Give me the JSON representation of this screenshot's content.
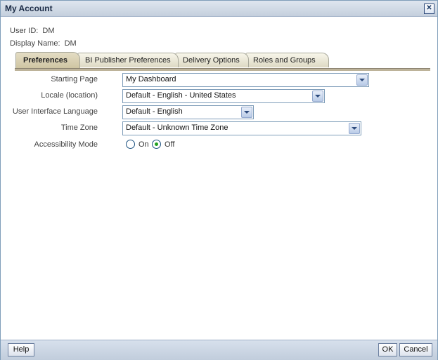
{
  "dialog": {
    "title": "My Account",
    "close_icon": "close-icon (X)"
  },
  "user_info": {
    "user_id_label": "User ID:",
    "user_id_value": "DM",
    "display_name_label": "Display Name:",
    "display_name_value": "DM"
  },
  "tabs": [
    {
      "label": "Preferences",
      "active": true
    },
    {
      "label": "BI Publisher Preferences",
      "active": false
    },
    {
      "label": "Delivery Options",
      "active": false
    },
    {
      "label": "Roles and Groups",
      "active": false
    }
  ],
  "form": {
    "starting_page": {
      "label": "Starting Page",
      "value": "My Dashboard"
    },
    "locale": {
      "label": "Locale (location)",
      "value": "Default - English - United States"
    },
    "ui_language": {
      "label": "User Interface Language",
      "value": "Default - English"
    },
    "time_zone": {
      "label": "Time Zone",
      "value": "Default - Unknown Time Zone"
    },
    "accessibility": {
      "label": "Accessibility Mode",
      "options": [
        {
          "label": "On",
          "checked": false
        },
        {
          "label": "Off",
          "checked": true
        }
      ]
    }
  },
  "footer": {
    "help_label": "Help",
    "ok_label": "OK",
    "cancel_label": "Cancel"
  },
  "colors": {
    "titlebar": "#c4cfdd",
    "active_tab": "#cfc5a3",
    "radio_selected": "#21a121"
  }
}
